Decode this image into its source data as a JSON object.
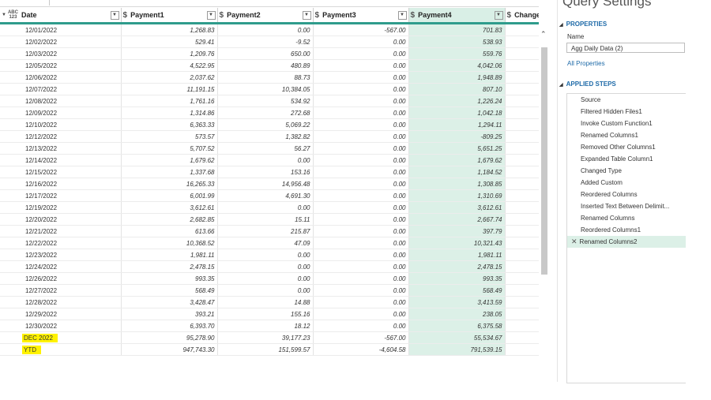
{
  "grid": {
    "columns": [
      {
        "type": "ABC\n123",
        "label": "Date"
      },
      {
        "type": "$",
        "label": "Payment1"
      },
      {
        "type": "$",
        "label": "Payment2"
      },
      {
        "type": "$",
        "label": "Payment3"
      },
      {
        "type": "$",
        "label": "Payment4"
      },
      {
        "type": "$",
        "label": "Change in"
      }
    ],
    "rows": [
      [
        "12/01/2022",
        "1,268.83",
        "0.00",
        "-567.00",
        "701.83"
      ],
      [
        "12/02/2022",
        "529.41",
        "-9.52",
        "0.00",
        "538.93"
      ],
      [
        "12/03/2022",
        "1,209.76",
        "650.00",
        "0.00",
        "559.76"
      ],
      [
        "12/05/2022",
        "4,522.95",
        "480.89",
        "0.00",
        "4,042.06"
      ],
      [
        "12/06/2022",
        "2,037.62",
        "88.73",
        "0.00",
        "1,948.89"
      ],
      [
        "12/07/2022",
        "11,191.15",
        "10,384.05",
        "0.00",
        "807.10"
      ],
      [
        "12/08/2022",
        "1,761.16",
        "534.92",
        "0.00",
        "1,226.24"
      ],
      [
        "12/09/2022",
        "1,314.86",
        "272.68",
        "0.00",
        "1,042.18"
      ],
      [
        "12/10/2022",
        "6,363.33",
        "5,069.22",
        "0.00",
        "1,294.11"
      ],
      [
        "12/12/2022",
        "573.57",
        "1,382.82",
        "0.00",
        "-809.25"
      ],
      [
        "12/13/2022",
        "5,707.52",
        "56.27",
        "0.00",
        "5,651.25"
      ],
      [
        "12/14/2022",
        "1,679.62",
        "0.00",
        "0.00",
        "1,679.62"
      ],
      [
        "12/15/2022",
        "1,337.68",
        "153.16",
        "0.00",
        "1,184.52"
      ],
      [
        "12/16/2022",
        "16,265.33",
        "14,956.48",
        "0.00",
        "1,308.85"
      ],
      [
        "12/17/2022",
        "6,001.99",
        "4,691.30",
        "0.00",
        "1,310.69"
      ],
      [
        "12/19/2022",
        "3,612.61",
        "0.00",
        "0.00",
        "3,612.61"
      ],
      [
        "12/20/2022",
        "2,682.85",
        "15.11",
        "0.00",
        "2,667.74"
      ],
      [
        "12/21/2022",
        "613.66",
        "215.87",
        "0.00",
        "397.79"
      ],
      [
        "12/22/2022",
        "10,368.52",
        "47.09",
        "0.00",
        "10,321.43"
      ],
      [
        "12/23/2022",
        "1,981.11",
        "0.00",
        "0.00",
        "1,981.11"
      ],
      [
        "12/24/2022",
        "2,478.15",
        "0.00",
        "0.00",
        "2,478.15"
      ],
      [
        "12/26/2022",
        "993.35",
        "0.00",
        "0.00",
        "993.35"
      ],
      [
        "12/27/2022",
        "568.49",
        "0.00",
        "0.00",
        "568.49"
      ],
      [
        "12/28/2022",
        "3,428.47",
        "14.88",
        "0.00",
        "3,413.59"
      ],
      [
        "12/29/2022",
        "393.21",
        "155.16",
        "0.00",
        "238.05"
      ],
      [
        "12/30/2022",
        "6,393.70",
        "18.12",
        "0.00",
        "6,375.58"
      ]
    ],
    "summary_rows": [
      [
        "DEC 2022",
        "95,278.90",
        "39,177.23",
        "-567.00",
        "55,534.67"
      ],
      [
        "YTD",
        "947,743.30",
        "151,599.57",
        "-4,604.58",
        "791,539.15"
      ]
    ]
  },
  "panel": {
    "title": "Query Settings",
    "properties_header": "PROPERTIES",
    "name_label": "Name",
    "name_value": "Agg Daily Data (2)",
    "all_properties": "All Properties",
    "steps_header": "APPLIED STEPS",
    "steps": [
      "Source",
      "Filtered Hidden Files1",
      "Invoke Custom Function1",
      "Renamed Columns1",
      "Removed Other Columns1",
      "Expanded Table Column1",
      "Changed Type",
      "Added Custom",
      "Reordered Columns",
      "Inserted Text Between Delimit...",
      "Renamed Columns",
      "Reordered Columns1",
      "Renamed Columns2"
    ],
    "active_step": 12
  },
  "colors": {
    "header_underline": "#2f9c8c",
    "selected_column": "#dcf0e7",
    "highlight": "#fff200",
    "accent_text": "#1e6aa8"
  }
}
